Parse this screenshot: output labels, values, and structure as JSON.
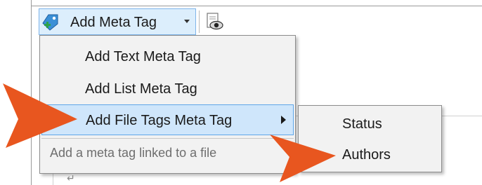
{
  "toolbar": {
    "add_meta_tag_label": "Add Meta Tag",
    "icons": [
      "tag-add-icon",
      "chevron-down-icon",
      "preview-icon"
    ]
  },
  "menu": {
    "items": [
      {
        "label": "Add Text Meta Tag"
      },
      {
        "label": "Add List Meta Tag"
      },
      {
        "label": "Add File Tags Meta Tag",
        "has_submenu": true,
        "highlighted": true
      }
    ],
    "hint": "Add a meta tag linked to a file"
  },
  "submenu": {
    "items": [
      {
        "label": "Status"
      },
      {
        "label": "Authors"
      }
    ]
  },
  "colors": {
    "highlight": "#cfe6fb",
    "highlight_border": "#5ea6e8",
    "callout_arrow": "#e8561f",
    "menu_background": "#f2f2f2"
  }
}
